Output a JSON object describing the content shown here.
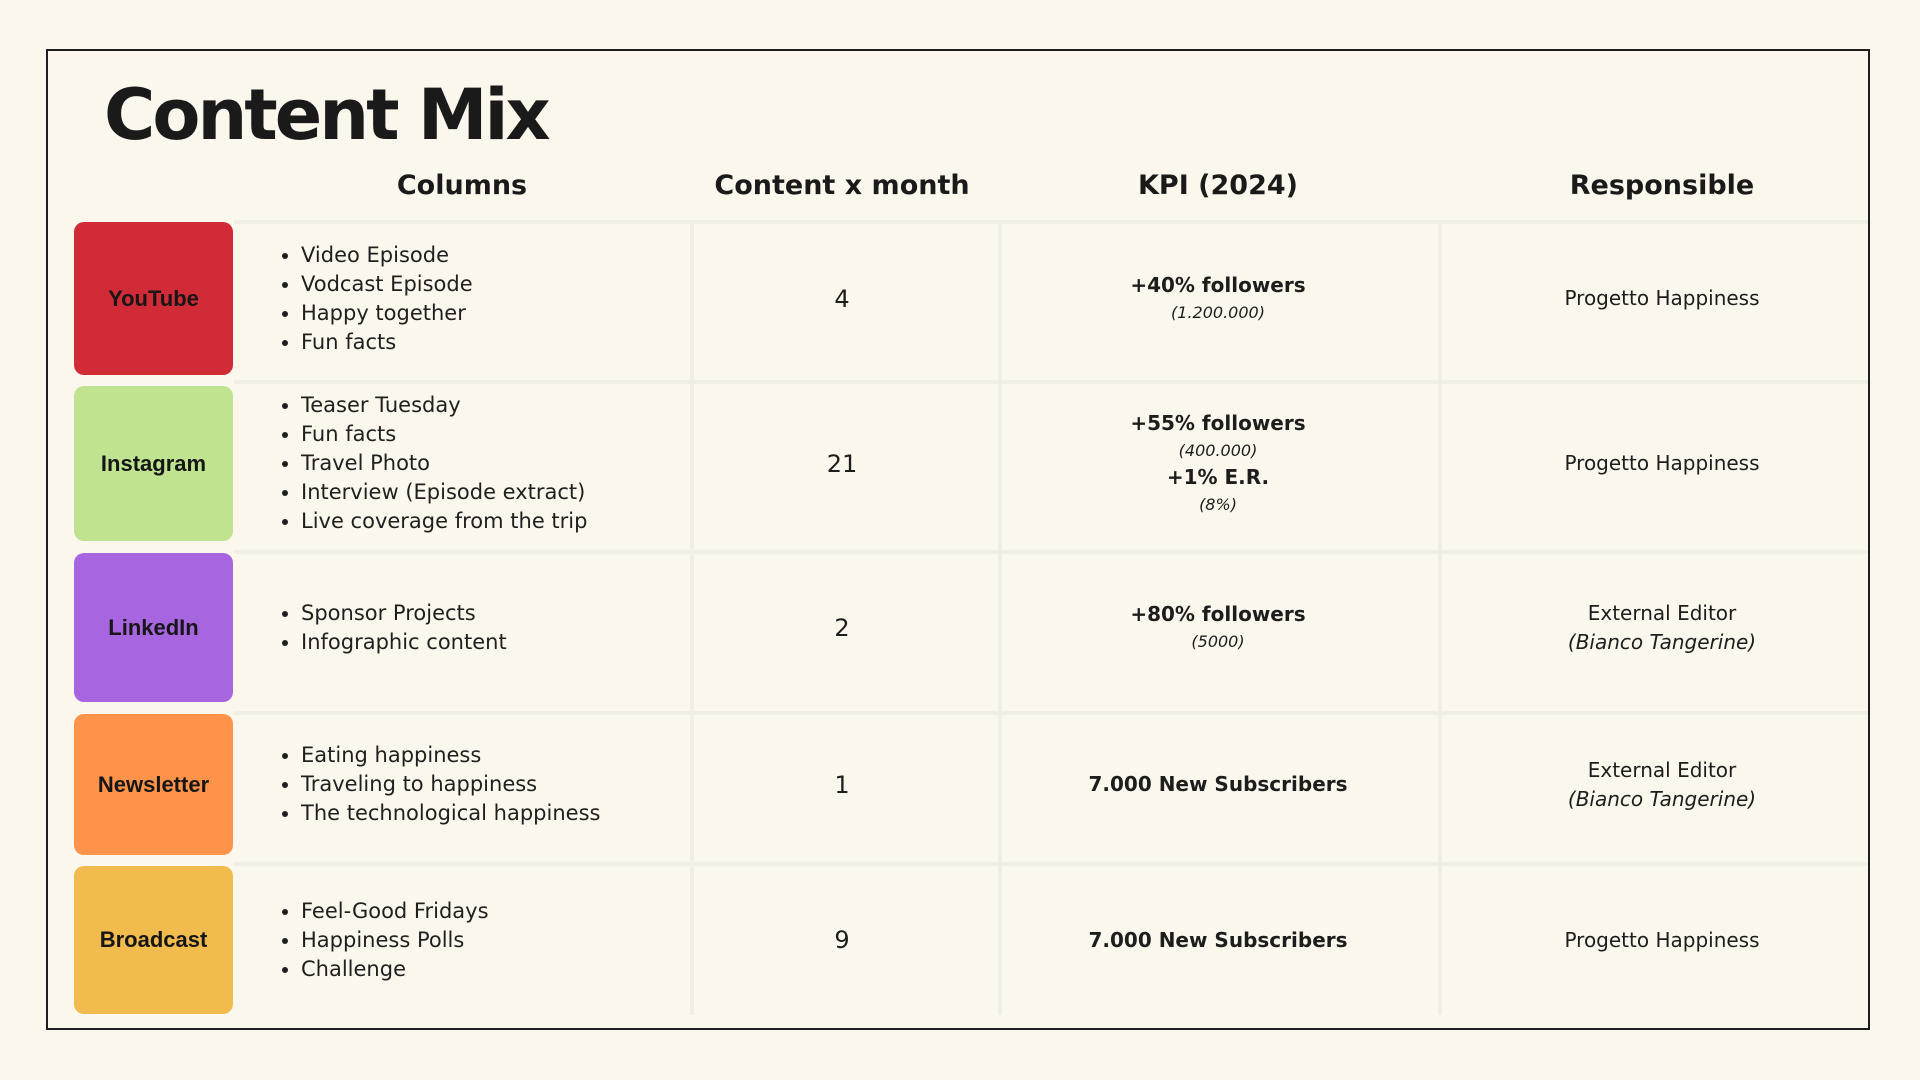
{
  "title": "Content Mix",
  "headers": {
    "columns": "Columns",
    "content_x_month": "Content x month",
    "kpi": "KPI (2024)",
    "responsible": "Responsible"
  },
  "rows": [
    {
      "platform": "YouTube",
      "color": "#d12b38",
      "columns": [
        "Video Episode",
        "Vodcast Episode",
        "Happy together",
        "Fun facts"
      ],
      "count": "4",
      "kpi": [
        {
          "main": "+40% followers",
          "sub": "(1.200.000)"
        }
      ],
      "responsible": "Progetto Happiness",
      "responsible_sub": ""
    },
    {
      "platform": "Instagram",
      "color": "#bfe38e",
      "columns": [
        "Teaser Tuesday",
        "Fun facts",
        "Travel Photo",
        "Interview (Episode extract)",
        "Live coverage from the trip"
      ],
      "count": "21",
      "kpi": [
        {
          "main": "+55% followers",
          "sub": "(400.000)"
        },
        {
          "main": "+1% E.R.",
          "sub": "(8%)"
        }
      ],
      "responsible": "Progetto Happiness",
      "responsible_sub": ""
    },
    {
      "platform": "LinkedIn",
      "color": "#a865e0",
      "columns": [
        "Sponsor Projects",
        "Infographic content"
      ],
      "count": "2",
      "kpi": [
        {
          "main": "+80% followers",
          "sub": "(5000)"
        }
      ],
      "responsible": "External Editor",
      "responsible_sub": "(Bianco Tangerine)"
    },
    {
      "platform": "Newsletter",
      "color": "#ff934a",
      "columns": [
        "Eating happiness",
        "Traveling to happiness",
        "The technological happiness"
      ],
      "count": "1",
      "kpi": [
        {
          "main": "7.000 New Subscribers",
          "sub": ""
        }
      ],
      "responsible": "External Editor",
      "responsible_sub": "(Bianco Tangerine)"
    },
    {
      "platform": "Broadcast",
      "color": "#f1bb4e",
      "columns": [
        "Feel-Good Fridays",
        "Happiness Polls",
        "Challenge"
      ],
      "count": "9",
      "kpi": [
        {
          "main": "7.000 New Subscribers",
          "sub": ""
        }
      ],
      "responsible": "Progetto Happiness",
      "responsible_sub": ""
    }
  ]
}
